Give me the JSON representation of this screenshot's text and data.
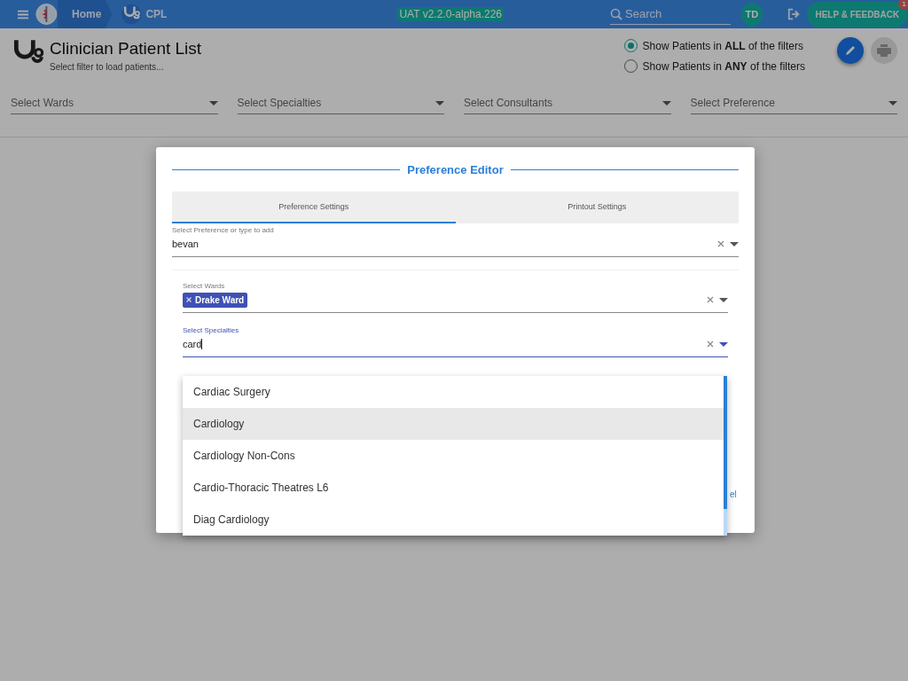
{
  "header": {
    "breadcrumbs": [
      {
        "label": "Home"
      },
      {
        "label": "CPL"
      }
    ],
    "version": "UAT v2.2.0-alpha.226",
    "search": {
      "placeholder": "Search"
    },
    "avatar": "TD",
    "help_button": {
      "label": "HELP & FEEDBACK",
      "badge": "1"
    }
  },
  "page": {
    "title": "Clinician Patient List",
    "subtitle": "Select filter to load patients...",
    "filter_mode": [
      {
        "label": "Show Patients in **ALL** of the filters",
        "selected": true
      },
      {
        "label": "Show Patients in **ANY** of the filters",
        "selected": false
      }
    ],
    "filters": [
      {
        "placeholder": "Select Wards"
      },
      {
        "placeholder": "Select Specialties"
      },
      {
        "placeholder": "Select Consultants"
      },
      {
        "placeholder": "Select Preference"
      }
    ]
  },
  "dialog": {
    "title": "Preference Editor",
    "tabs": [
      {
        "label": "Preference Settings",
        "selected": true
      },
      {
        "label": "Printout Settings",
        "selected": false
      }
    ],
    "preference_field": {
      "label": "Select Preference or type to add",
      "value": "bevan"
    },
    "wards_field": {
      "label": "Select Wards",
      "chips": [
        "Drake Ward"
      ],
      "focused": false
    },
    "specialties_field": {
      "label": "Select Specialties",
      "value": "card",
      "focused": true
    },
    "options": [
      {
        "label": "Cardiac Surgery",
        "selected": false
      },
      {
        "label": "Cardiology",
        "selected": true
      },
      {
        "label": "Cardiology Non-Cons",
        "selected": false
      },
      {
        "label": "Cardio-Thoracic Theatres L6",
        "selected": false
      },
      {
        "label": "Diag Cardiology",
        "selected": false
      }
    ],
    "link": "el"
  }
}
